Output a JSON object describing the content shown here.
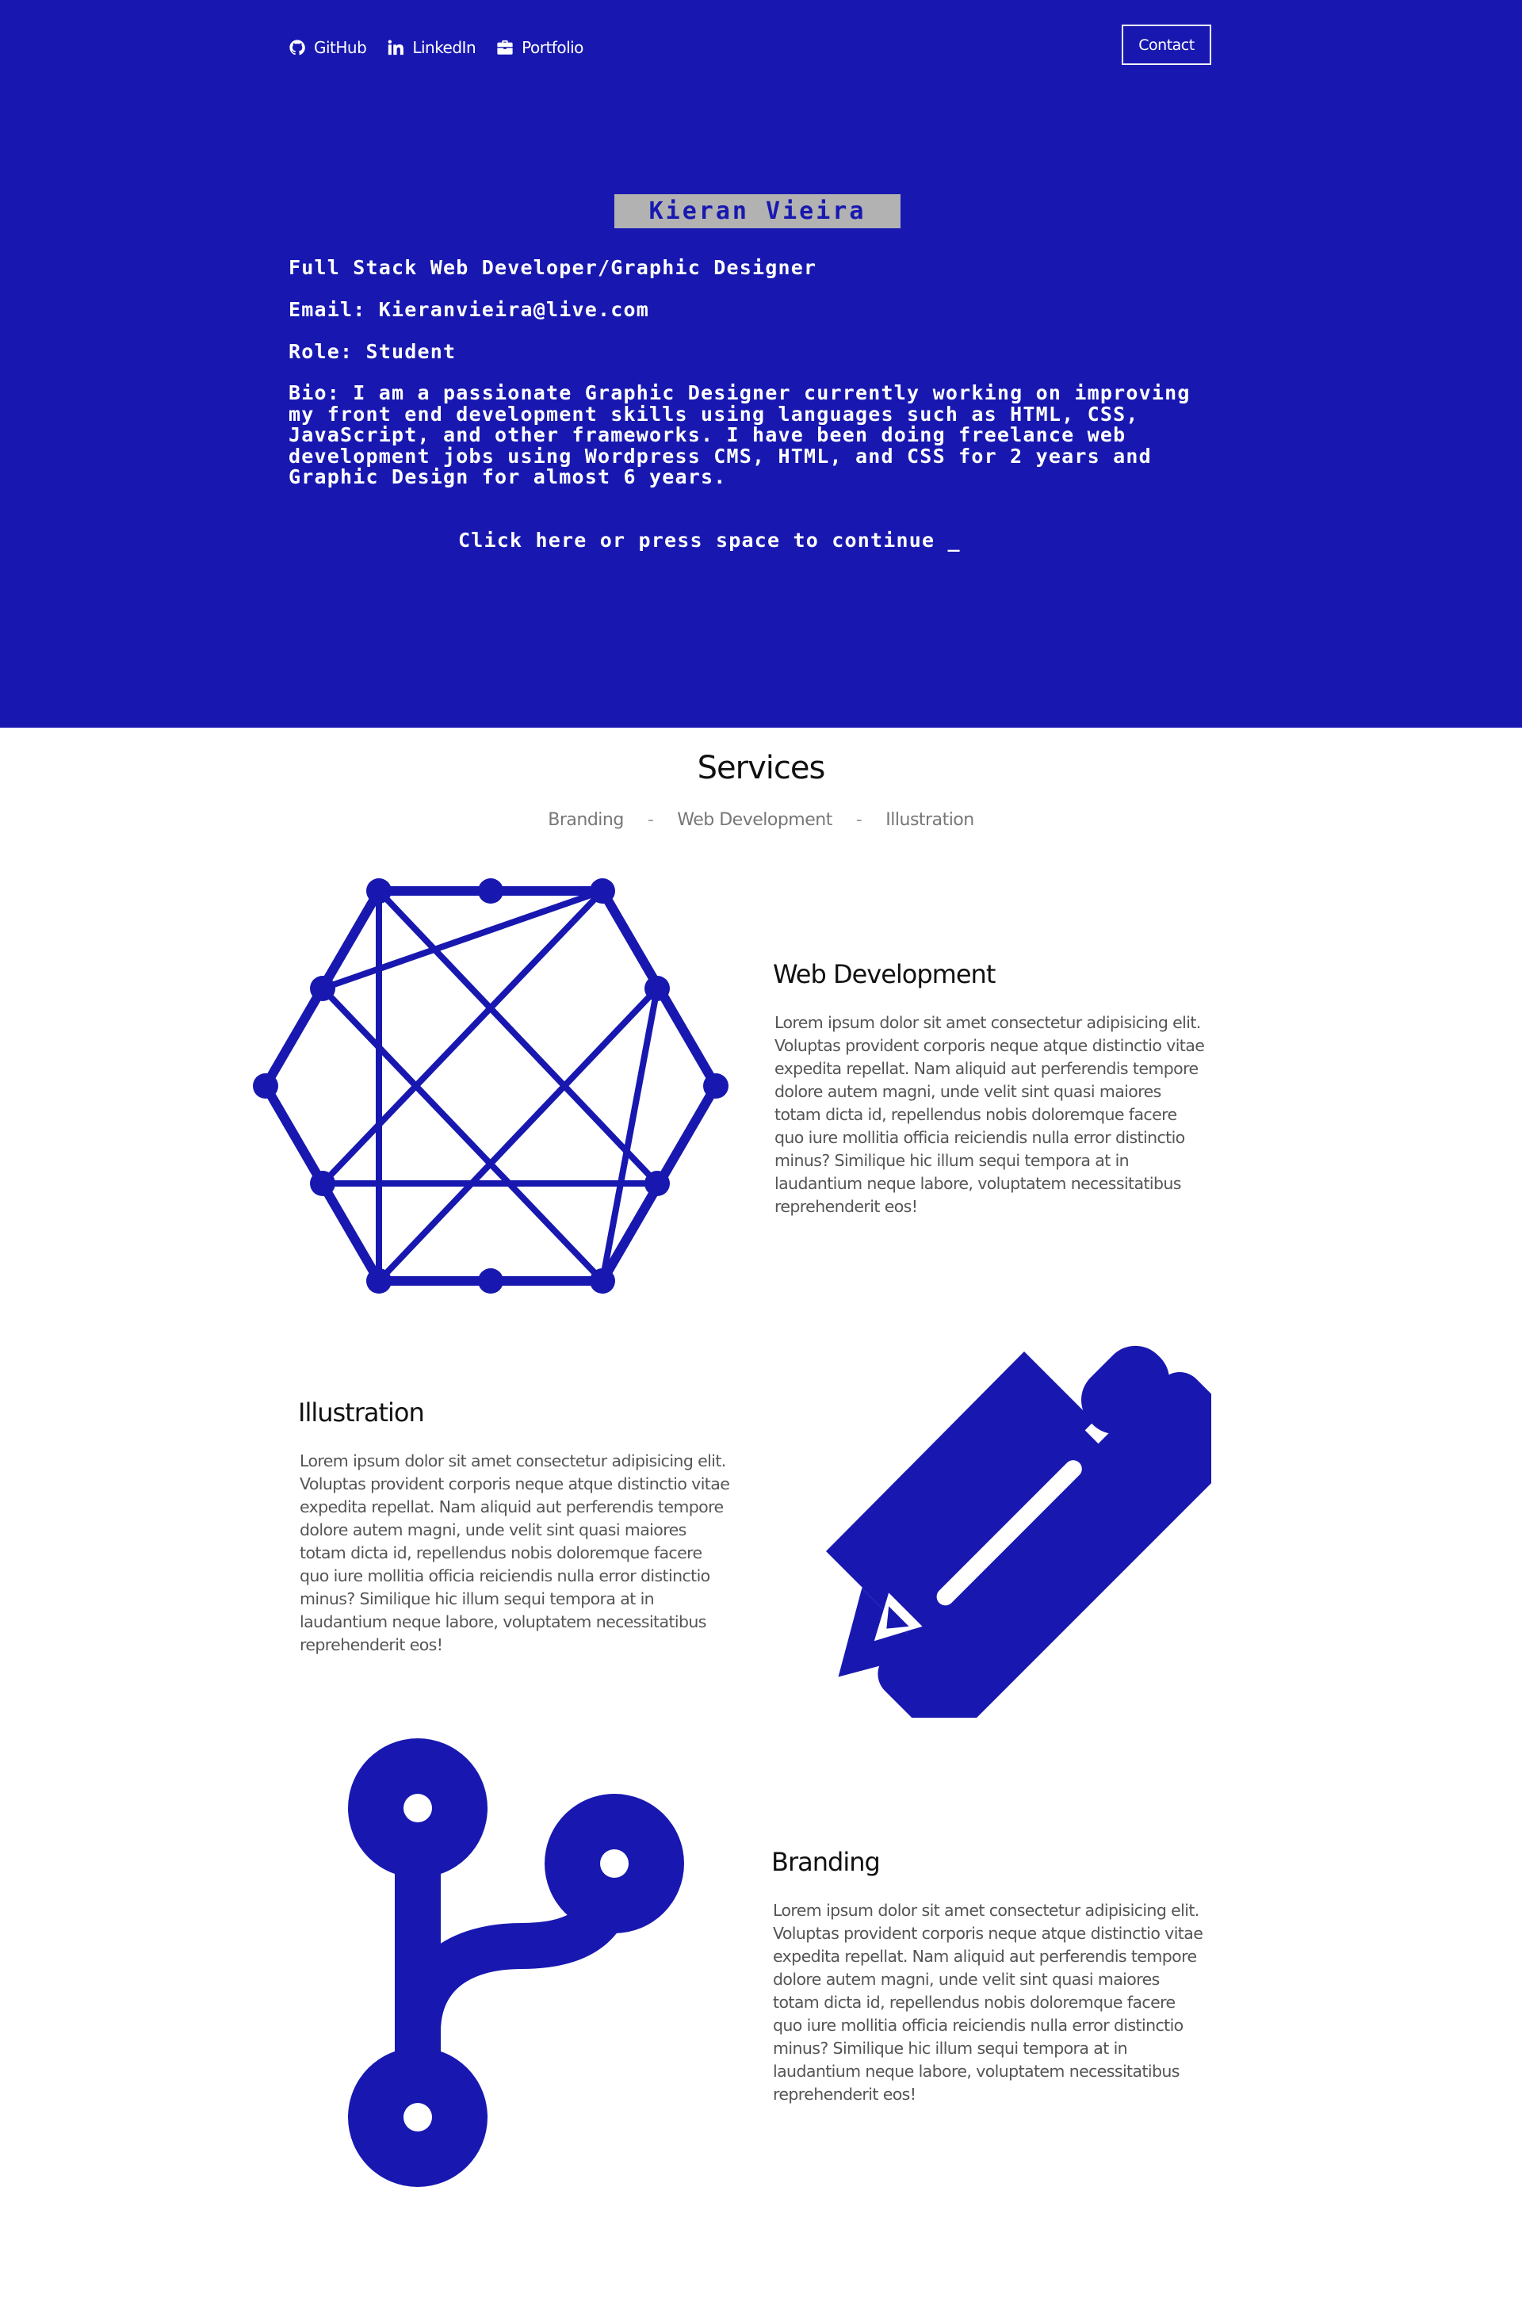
{
  "nav": {
    "github": {
      "label": "GitHub",
      "icon": "github-icon"
    },
    "linkedin": {
      "label": "LinkedIn",
      "icon": "linkedin-icon"
    },
    "portfolio": {
      "label": "Portfolio",
      "icon": "briefcase-icon"
    },
    "contact_label": "Contact"
  },
  "hero": {
    "name": "Kieran Vieira",
    "title": "Full Stack Web Developer/Graphic Designer",
    "email": "Email: Kieranvieira@live.com",
    "role": "Role: Student",
    "bio": "Bio: I am a passionate Graphic Designer currently working on improving my front end development skills using languages such as HTML, CSS, JavaScript, and other frameworks. I have been doing freelance web development jobs using Wordpress CMS, HTML, and CSS for 2 years and Graphic Design for almost 6 years.",
    "continue": "Click here or press space to continue _"
  },
  "services": {
    "title": "Services",
    "tabs": [
      "Branding",
      "Web Development",
      "Illustration"
    ],
    "separator": "-",
    "blocks": [
      {
        "title": "Web Development",
        "icon": "network-hexagon-icon",
        "text": "Lorem ipsum dolor sit amet consectetur adipisicing elit. Voluptas provident corporis neque atque distinctio vitae expedita repellat. Nam aliquid aut perferendis tempore dolore autem magni, unde velit sint quasi maiores totam dicta id, repellendus nobis doloremque facere quo iure mollitia officia reiciendis nulla error distinctio minus? Similique hic illum sequi tempora at in laudantium neque labore, voluptatem necessitatibus reprehenderit eos!"
      },
      {
        "title": "Illustration",
        "icon": "pencil-icon",
        "text": "Lorem ipsum dolor sit amet consectetur adipisicing elit. Voluptas provident corporis neque atque distinctio vitae expedita repellat. Nam aliquid aut perferendis tempore dolore autem magni, unde velit sint quasi maiores totam dicta id, repellendus nobis doloremque facere quo iure mollitia officia reiciendis nulla error distinctio minus? Similique hic illum sequi tempora at in laudantium neque labore, voluptatem necessitatibus reprehenderit eos!"
      },
      {
        "title": "Branding",
        "icon": "code-branch-icon",
        "text": "Lorem ipsum dolor sit amet consectetur adipisicing elit. Voluptas provident corporis neque atque distinctio vitae expedita repellat. Nam aliquid aut perferendis tempore dolore autem magni, unde velit sint quasi maiores totam dicta id, repellendus nobis doloremque facere quo iure mollitia officia reiciendis nulla error distinctio minus? Similique hic illum sequi tempora at in laudantium neque labore, voluptatem necessitatibus reprehenderit eos!"
      }
    ]
  },
  "colors": {
    "brand_blue": "#1818b0",
    "name_box_gray": "#b2b2b2",
    "text_gray": "#555555"
  }
}
